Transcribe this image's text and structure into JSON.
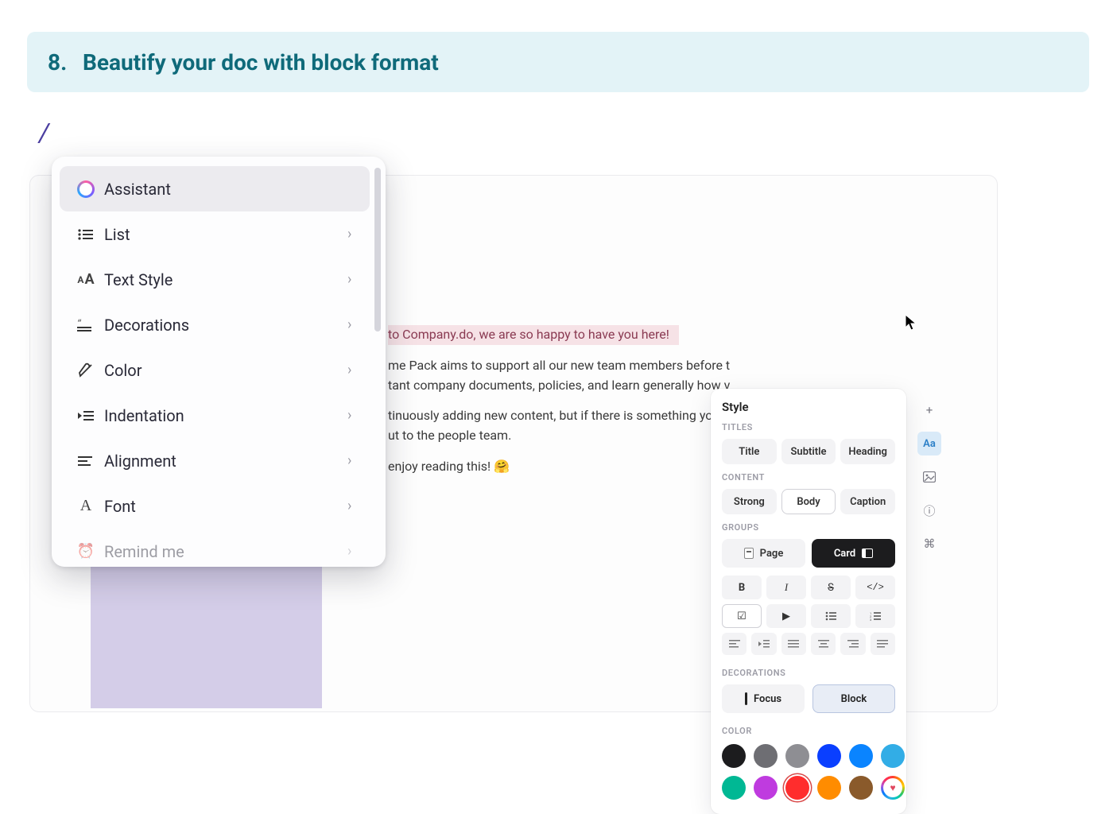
{
  "header": {
    "number": "8.",
    "title": "Beautify your doc with block format"
  },
  "slash": "/",
  "menu": {
    "items": [
      {
        "label": "Assistant",
        "icon": "gradient-circle",
        "chevron": false,
        "selected": true
      },
      {
        "label": "List",
        "icon": "list",
        "chevron": true,
        "selected": false
      },
      {
        "label": "Text Style",
        "icon": "aa",
        "chevron": true,
        "selected": false
      },
      {
        "label": "Decorations",
        "icon": "deco",
        "chevron": true,
        "selected": false
      },
      {
        "label": "Color",
        "icon": "color",
        "chevron": true,
        "selected": false
      },
      {
        "label": "Indentation",
        "icon": "indent",
        "chevron": true,
        "selected": false
      },
      {
        "label": "Alignment",
        "icon": "align",
        "chevron": true,
        "selected": false
      },
      {
        "label": "Font",
        "icon": "font",
        "chevron": true,
        "selected": false
      },
      {
        "label": "Remind me",
        "icon": "remind",
        "chevron": true,
        "selected": false
      }
    ]
  },
  "doc": {
    "line1": "to Company.do, we are so happy to have you here!",
    "para1a": "me Pack aims to support all our new team members before t",
    "para1b": "tant company documents, policies, and learn generally how v",
    "para2a": "tinuously adding new content, but if there is something you c",
    "para2b": "ut to the people team.",
    "para3": "enjoy reading this! 🤗"
  },
  "style_panel": {
    "title": "Style",
    "sections": {
      "titles": "TITLES",
      "content": "CONTENT",
      "groups": "GROUPS",
      "decorations": "DECORATIONS",
      "color": "COLOR"
    },
    "titles": [
      {
        "label": "Title"
      },
      {
        "label": "Subtitle"
      },
      {
        "label": "Heading"
      }
    ],
    "content": [
      {
        "label": "Strong"
      },
      {
        "label": "Body",
        "active": true
      },
      {
        "label": "Caption"
      }
    ],
    "groups": {
      "page": "Page",
      "card": "Card",
      "active": "card"
    },
    "formatting": [
      {
        "id": "bold",
        "glyph": "B"
      },
      {
        "id": "italic",
        "glyph": "I"
      },
      {
        "id": "strike",
        "glyph": "S"
      },
      {
        "id": "code",
        "glyph": "</>"
      }
    ],
    "lists": [
      {
        "id": "checklist"
      },
      {
        "id": "toggle"
      },
      {
        "id": "bulleted"
      },
      {
        "id": "numbered"
      }
    ],
    "align": [
      {
        "id": "align-left"
      },
      {
        "id": "indent-increase"
      },
      {
        "id": "align-justify"
      },
      {
        "id": "align-center"
      },
      {
        "id": "align-right"
      },
      {
        "id": "align-full"
      }
    ],
    "decorations": [
      {
        "label": "Focus",
        "active": false
      },
      {
        "label": "Block",
        "active": true
      }
    ],
    "colors": [
      "#1c1c1e",
      "#6e6e73",
      "#8e8e93",
      "#0a3fff",
      "#0a84ff",
      "#32ade6",
      "#00b894",
      "#bf3bdf",
      "#ff2d2d",
      "#ff8c00",
      "#8a5a2b",
      "rainbow"
    ],
    "color_ring_index": 8
  },
  "sidebar": {
    "items": [
      {
        "id": "add",
        "glyph": "+"
      },
      {
        "id": "style",
        "glyph": "Aa",
        "active": true
      },
      {
        "id": "image",
        "glyph": "▢"
      },
      {
        "id": "info",
        "glyph": "ⓘ"
      },
      {
        "id": "cmd",
        "glyph": "⌘"
      }
    ]
  }
}
